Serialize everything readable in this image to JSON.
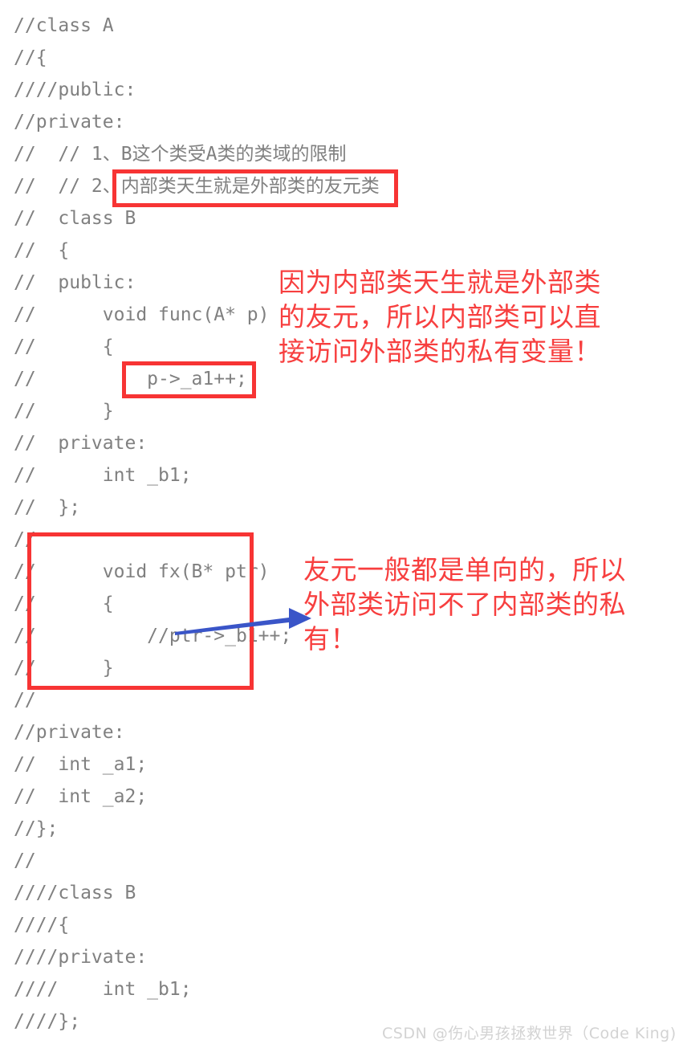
{
  "colors": {
    "code_text": "#808080",
    "annotation_red": "#f73f3f",
    "box_red": "#f73434",
    "arrow_blue": "#3a55c8",
    "watermark": "#d3d3d3",
    "background": "#ffffff"
  },
  "code": {
    "lines": [
      "//class A",
      "//{",
      "////public:",
      "//private:",
      "//  // 1、B这个类受A类的类域的限制",
      "//  // 2、内部类天生就是外部类的友元类",
      "//  class B",
      "//  {",
      "//  public:",
      "//      void func(A* p)",
      "//      {",
      "//          p->_a1++;",
      "//      }",
      "//  private:",
      "//      int _b1;",
      "//  };",
      "//",
      "//      void fx(B* ptr)",
      "//      {",
      "//          //ptr->_b1++;",
      "//      }",
      "//",
      "//private:",
      "//  int _a1;",
      "//  int _a2;",
      "//};",
      "//",
      "////class B",
      "////{",
      "////private:",
      "////    int _b1;",
      "////};"
    ]
  },
  "highlights": {
    "inner_class_label": "内部类天生就是外部类的友元类",
    "a1_label": "p->_a1++;",
    "fx_label": "void fx(B* ptr)"
  },
  "annotations": {
    "friend_access": "因为内部类天生就是外部类\n的友元，所以内部类可以直\n接访问外部类的私有变量！",
    "one_way": "友元一般都是单向的，所以\n外部类访问不了内部类的私\n有！"
  },
  "watermark": {
    "text": "CSDN @伤心男孩拯救世界（Code King)"
  }
}
